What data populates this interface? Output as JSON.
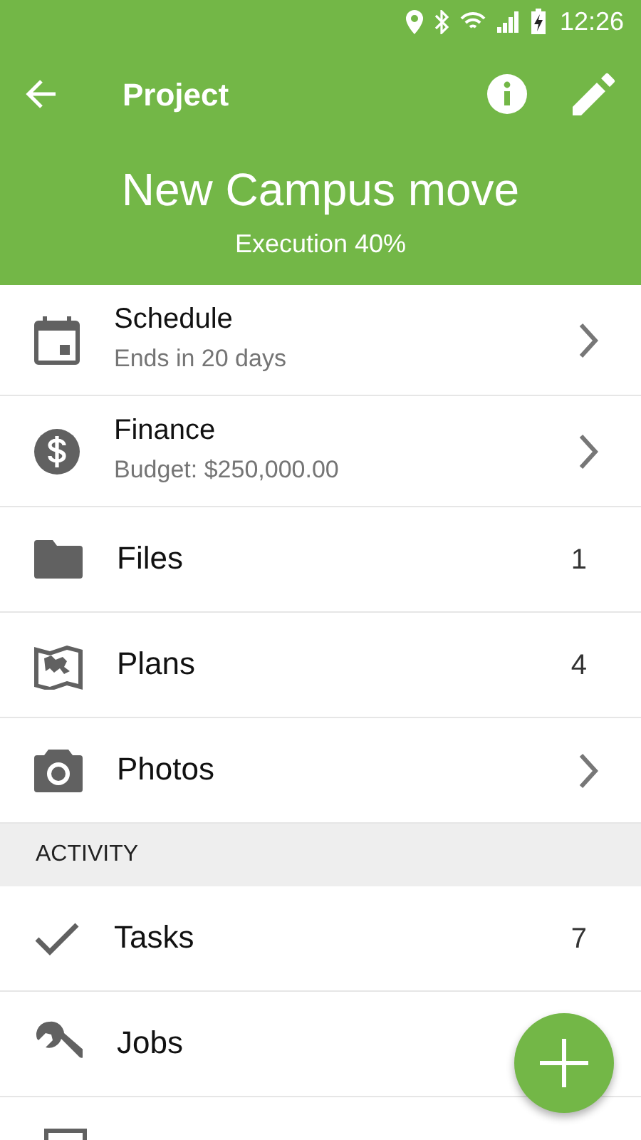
{
  "status_bar": {
    "time": "12:26"
  },
  "toolbar": {
    "title": "Project"
  },
  "header": {
    "title": "New Campus move",
    "subtitle": "Execution 40%"
  },
  "items": [
    {
      "kind": "link",
      "label": "Schedule",
      "detail": "Ends in 20 days"
    },
    {
      "kind": "link",
      "label": "Finance",
      "detail": "Budget: $250,000.00"
    },
    {
      "kind": "count",
      "label": "Files",
      "count": "1"
    },
    {
      "kind": "count",
      "label": "Plans",
      "count": "4"
    },
    {
      "kind": "link",
      "label": "Photos"
    }
  ],
  "activity": {
    "heading": "ACTIVITY",
    "items": [
      {
        "kind": "count",
        "label": "Tasks",
        "count": "7"
      },
      {
        "kind": "plain",
        "label": "Jobs"
      }
    ]
  }
}
